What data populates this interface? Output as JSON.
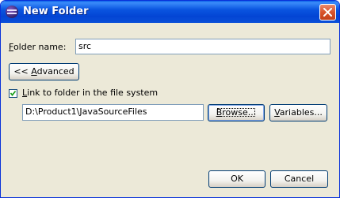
{
  "window": {
    "title": "New Folder"
  },
  "folder_name": {
    "label_prefix": "",
    "label_mnemonic": "F",
    "label_rest": "older name:",
    "value": "src"
  },
  "advanced_button": {
    "prefix": "<< ",
    "mnemonic": "A",
    "rest": "dvanced"
  },
  "link_checkbox": {
    "checked": true,
    "mnemonic": "L",
    "rest": "ink to folder in the file system"
  },
  "path": {
    "value": "D:\\Product1\\JavaSourceFiles"
  },
  "browse_button": {
    "mnemonic": "B",
    "rest": "rowse..."
  },
  "variables_button": {
    "mnemonic": "V",
    "rest": "ariables..."
  },
  "ok_button": {
    "label": "OK"
  },
  "cancel_button": {
    "label": "Cancel"
  }
}
